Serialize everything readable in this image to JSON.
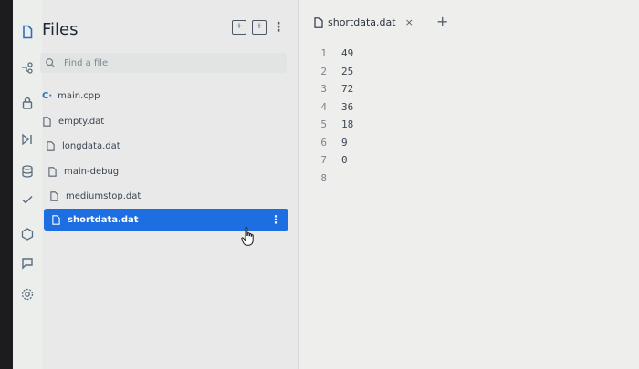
{
  "files_panel": {
    "title": "Files",
    "search_placeholder": "Find a file",
    "items": [
      {
        "name": "main.cpp",
        "type": "cpp"
      },
      {
        "name": "empty.dat",
        "type": "file"
      },
      {
        "name": "longdata.dat",
        "type": "file"
      },
      {
        "name": "main-debug",
        "type": "file"
      },
      {
        "name": "mediumstop.dat",
        "type": "file"
      },
      {
        "name": "shortdata.dat",
        "type": "file",
        "selected": true
      }
    ]
  },
  "editor": {
    "tab_label": "shortdata.dat",
    "close_label": "×",
    "add_label": "+",
    "lines": [
      {
        "num": "1",
        "text": "49"
      },
      {
        "num": "2",
        "text": "25"
      },
      {
        "num": "3",
        "text": "72"
      },
      {
        "num": "4",
        "text": "36"
      },
      {
        "num": "5",
        "text": "18"
      },
      {
        "num": "6",
        "text": "9"
      },
      {
        "num": "7",
        "text": "0"
      },
      {
        "num": "8",
        "text": ""
      }
    ]
  },
  "activity_bar": {
    "icons": [
      "file-icon",
      "git-icon",
      "lock-icon",
      "debug-icon",
      "database-icon",
      "check-icon",
      "package-icon",
      "chat-icon",
      "settings-icon"
    ]
  }
}
